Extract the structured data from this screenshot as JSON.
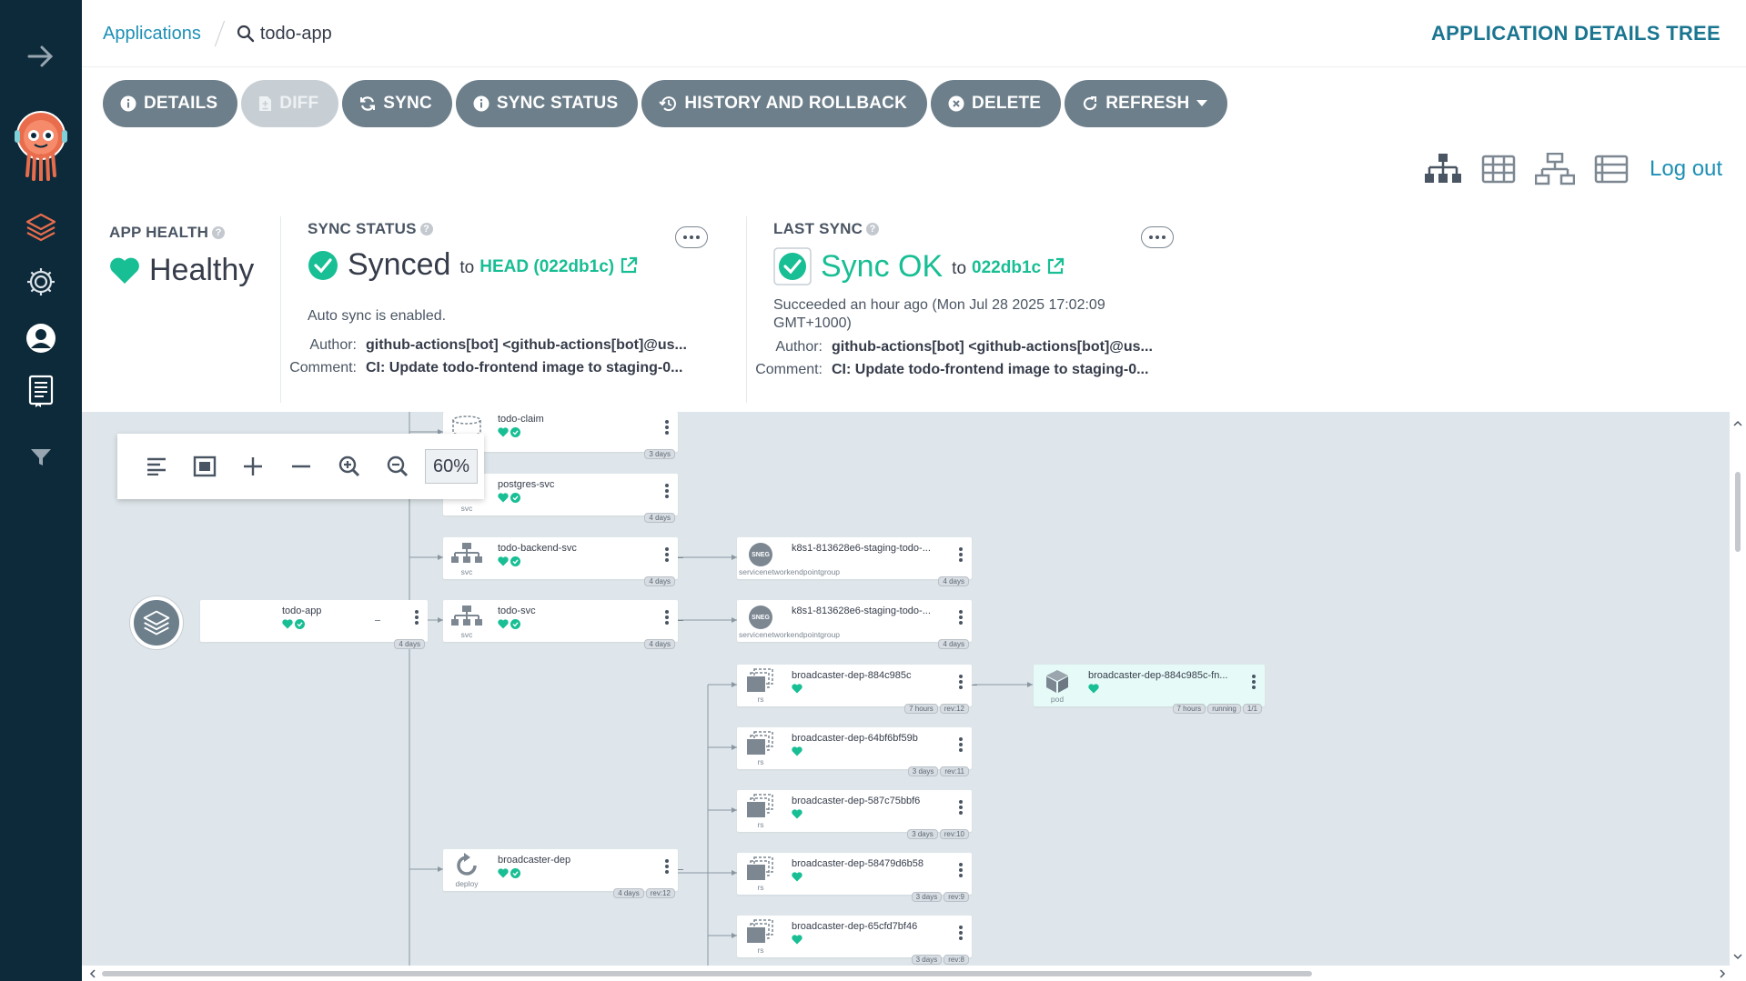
{
  "breadcrumb": {
    "link": "Applications",
    "current": "todo-app"
  },
  "header_title": "APPLICATION DETAILS TREE",
  "toolbar": {
    "details": "DETAILS",
    "diff": "DIFF",
    "sync": "SYNC",
    "sync_status": "SYNC STATUS",
    "history": "HISTORY AND ROLLBACK",
    "delete": "DELETE",
    "refresh": "REFRESH"
  },
  "views": {
    "logout": "Log out"
  },
  "app_health": {
    "label": "APP HEALTH",
    "value": "Healthy",
    "color": "#18be94"
  },
  "sync_status": {
    "label": "SYNC STATUS",
    "value": "Synced",
    "to_text": "to",
    "revision": "HEAD (022db1c)",
    "auto_sync": "Auto sync is enabled.",
    "author_label": "Author:",
    "author": "github-actions[bot] <github-actions[bot]@us...",
    "comment_label": "Comment:",
    "comment": "CI: Update todo-frontend image to staging-0..."
  },
  "last_sync": {
    "label": "LAST SYNC",
    "value": "Sync OK",
    "to_text": "to",
    "revision": "022db1c",
    "succeeded_line1": "Succeeded an hour ago (Mon Jul 28 2025 17:02:09",
    "succeeded_line2": "GMT+1000)",
    "author_label": "Author:",
    "author": "github-actions[bot] <github-actions[bot]@us...",
    "comment_label": "Comment:",
    "comment": "CI: Update todo-frontend image to staging-0..."
  },
  "zoom": {
    "level": "60%"
  },
  "nodes": {
    "app": {
      "name": "todo-app",
      "age": "4 days"
    },
    "todo_claim": {
      "name": "todo-claim",
      "age": "3 days",
      "type": ""
    },
    "postgres_svc": {
      "name": "postgres-svc",
      "age": "4 days",
      "type": "svc"
    },
    "backend_svc": {
      "name": "todo-backend-svc",
      "age": "4 days",
      "type": "svc"
    },
    "todo_svc": {
      "name": "todo-svc",
      "age": "4 days",
      "type": "svc"
    },
    "neg1": {
      "name": "k8s1-813628e6-staging-todo-...",
      "age": "4 days",
      "type": "servicenetworkendpointgroup",
      "icon": "SNEG"
    },
    "neg2": {
      "name": "k8s1-813628e6-staging-todo-...",
      "age": "4 days",
      "type": "servicenetworkendpointgroup",
      "icon": "SNEG"
    },
    "deploy": {
      "name": "broadcaster-dep",
      "age": "4 days",
      "rev": "rev:12",
      "type": "deploy"
    },
    "rs1": {
      "name": "broadcaster-dep-884c985c",
      "age": "7 hours",
      "rev": "rev:12",
      "type": "rs"
    },
    "rs2": {
      "name": "broadcaster-dep-64bf6bf59b",
      "age": "3 days",
      "rev": "rev:11",
      "type": "rs"
    },
    "rs3": {
      "name": "broadcaster-dep-587c75bbf6",
      "age": "3 days",
      "rev": "rev:10",
      "type": "rs"
    },
    "rs4": {
      "name": "broadcaster-dep-58479d6b58",
      "age": "3 days",
      "rev": "rev:9",
      "type": "rs"
    },
    "rs5": {
      "name": "broadcaster-dep-65cfd7bf46",
      "age": "3 days",
      "rev": "rev:8",
      "type": "rs"
    },
    "pod": {
      "name": "broadcaster-dep-884c985c-fn...",
      "age": "7 hours",
      "state": "running",
      "ready": "1/1",
      "type": "pod"
    }
  },
  "colors": {
    "accent": "#18be94",
    "link": "#1d8fb5",
    "sidebar": "#0d2a3a",
    "button": "#6d7f8b"
  }
}
